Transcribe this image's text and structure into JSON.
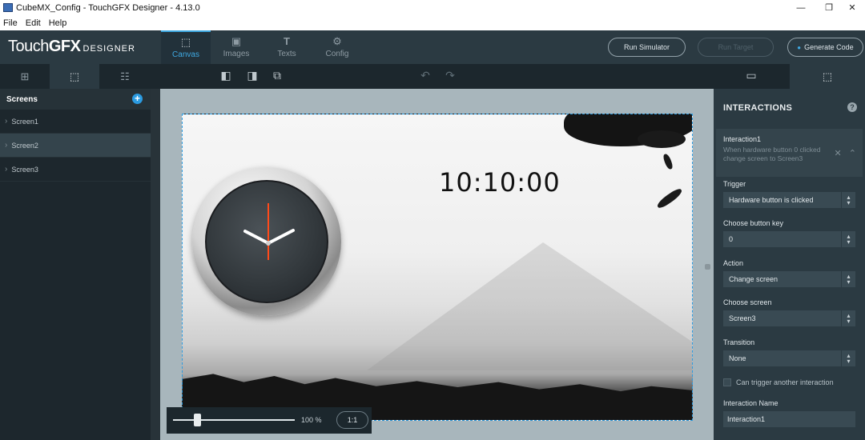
{
  "window": {
    "title": "CubeMX_Config - TouchGFX Designer - 4.13.0",
    "minimize": "—",
    "restore": "❐",
    "close": "✕"
  },
  "menu": {
    "items": [
      "File",
      "Edit",
      "Help"
    ]
  },
  "app": {
    "logo_touch": "Touch",
    "logo_gfx": "GFX",
    "logo_designer": "DESIGNER",
    "tabs": [
      {
        "label": "Canvas",
        "icon": "canvas-icon",
        "active": true
      },
      {
        "label": "Images",
        "icon": "images-icon",
        "active": false
      },
      {
        "label": "Texts",
        "icon": "texts-icon",
        "active": false
      },
      {
        "label": "Config",
        "icon": "config-icon",
        "active": false
      }
    ],
    "run_simulator": "Run Simulator",
    "run_target": "Run Target",
    "generate_code": "Generate Code",
    "accent_color": "#3fa9e2"
  },
  "screens": {
    "heading": "Screens",
    "items": [
      {
        "label": "Screen1",
        "selected": false
      },
      {
        "label": "Screen2",
        "selected": true
      },
      {
        "label": "Screen3",
        "selected": false
      }
    ]
  },
  "canvas": {
    "time_text": "10:10:00",
    "zoom_level": 0.2,
    "zoom_label": "100 %",
    "zoom_reset": "1:1"
  },
  "interactions": {
    "heading": "INTERACTIONS",
    "help": "?",
    "card": {
      "name": "Interaction1",
      "description": "When hardware button 0 clicked change screen to Screen3"
    },
    "trigger_label": "Trigger",
    "trigger_value": "Hardware button is clicked",
    "button_key_label": "Choose button key",
    "button_key_value": "0",
    "action_label": "Action",
    "action_value": "Change screen",
    "screen_label": "Choose screen",
    "screen_value": "Screen3",
    "transition_label": "Transition",
    "transition_value": "None",
    "can_trigger_label": "Can trigger another interaction",
    "name_label": "Interaction Name",
    "name_value": "Interaction1"
  }
}
